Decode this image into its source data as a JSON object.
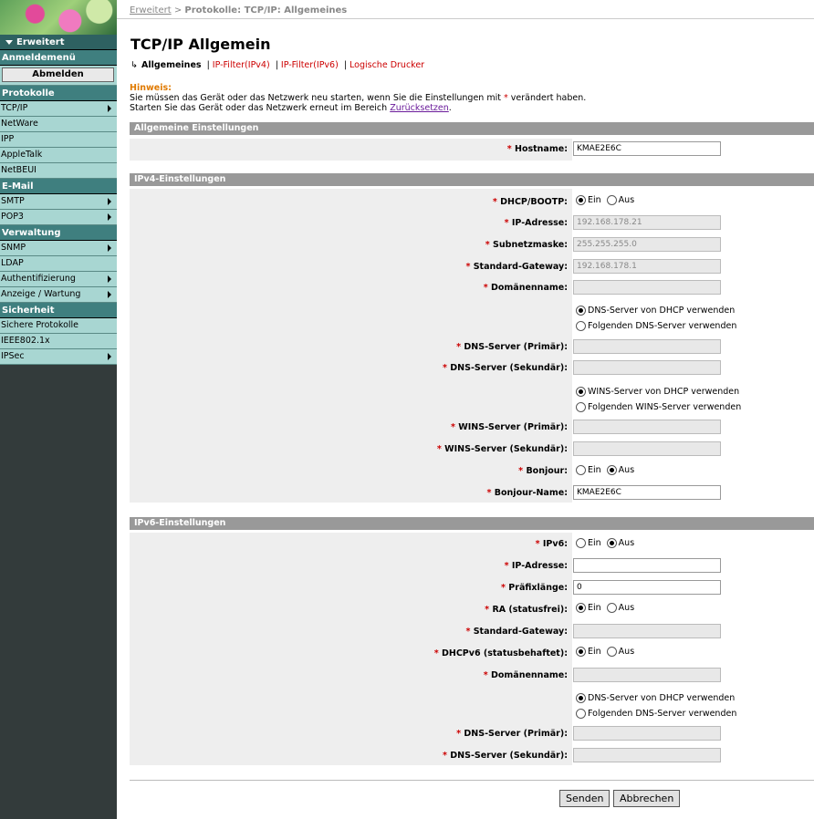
{
  "sidebar": {
    "expand_label": "Erweitert",
    "login_menu": "Anmeldemenü",
    "logout": "Abmelden",
    "groups": [
      {
        "title": "Protokolle",
        "items": [
          "TCP/IP",
          "NetWare",
          "IPP",
          "AppleTalk",
          "NetBEUI"
        ]
      },
      {
        "title": "E-Mail",
        "items": [
          "SMTP",
          "POP3"
        ]
      },
      {
        "title": "Verwaltung",
        "items": [
          "SNMP",
          "LDAP",
          "Authentifizierung",
          "Anzeige / Wartung"
        ]
      },
      {
        "title": "Sicherheit",
        "items": [
          "Sichere Protokolle",
          "IEEE802.1x",
          "IPSec"
        ]
      }
    ]
  },
  "breadcrumb": {
    "link": "Erweitert",
    "sep": ">",
    "current": "Protokolle: TCP/IP: Allgemeines"
  },
  "page_title": "TCP/IP Allgemein",
  "tabs": {
    "current": "Allgemeines",
    "links": [
      "IP-Filter(IPv4)",
      "IP-Filter(IPv6)",
      "Logische Drucker"
    ],
    "sep": "|"
  },
  "notice": {
    "hint": "Hinweis:",
    "line1a": "Sie müssen das Gerät oder das Netzwerk neu starten, wenn Sie die Einstellungen mit",
    "line1b": "verändert haben.",
    "line2a": "Starten Sie das Gerät oder das Netzwerk erneut im Bereich",
    "line2link": "Zurücksetzen",
    "line2b": "."
  },
  "sections": {
    "general": "Allgemeine Einstellungen",
    "ipv4": "IPv4-Einstellungen",
    "ipv6": "IPv6-Einstellungen"
  },
  "general": {
    "hostname_label": "Hostname:",
    "hostname": "KMAE2E6C"
  },
  "ipv4": {
    "dhcp_label": "DHCP/BOOTP:",
    "ip_label": "IP-Adresse:",
    "ip": "192.168.178.21",
    "mask_label": "Subnetzmaske:",
    "mask": "255.255.255.0",
    "gw_label": "Standard-Gateway:",
    "gw": "192.168.178.1",
    "domain_label": "Domänenname:",
    "domain": "",
    "dns_opt1": "DNS-Server von DHCP verwenden",
    "dns_opt2": "Folgenden DNS-Server verwenden",
    "dns1_label": "DNS-Server (Primär):",
    "dns2_label": "DNS-Server (Sekundär):",
    "wins_opt1": "WINS-Server von DHCP verwenden",
    "wins_opt2": "Folgenden WINS-Server verwenden",
    "wins1_label": "WINS-Server (Primär):",
    "wins2_label": "WINS-Server (Sekundär):",
    "bonjour_label": "Bonjour:",
    "bonjour_name_label": "Bonjour-Name:",
    "bonjour_name": "KMAE2E6C"
  },
  "ipv6": {
    "ipv6_label": "IPv6:",
    "ip_label": "IP-Adresse:",
    "ip": "",
    "prefix_label": "Präfixlänge:",
    "prefix": "0",
    "ra_label": "RA (statusfrei):",
    "gw_label": "Standard-Gateway:",
    "dhcpv6_label": "DHCPv6 (statusbehaftet):",
    "domain_label": "Domänenname:",
    "dns_opt1": "DNS-Server von DHCP verwenden",
    "dns_opt2": "Folgenden DNS-Server verwenden",
    "dns1_label": "DNS-Server (Primär):",
    "dns2_label": "DNS-Server (Sekundär):"
  },
  "radio": {
    "on": "Ein",
    "off": "Aus"
  },
  "required_mark": "*",
  "buttons": {
    "submit": "Senden",
    "cancel": "Abbrechen"
  }
}
